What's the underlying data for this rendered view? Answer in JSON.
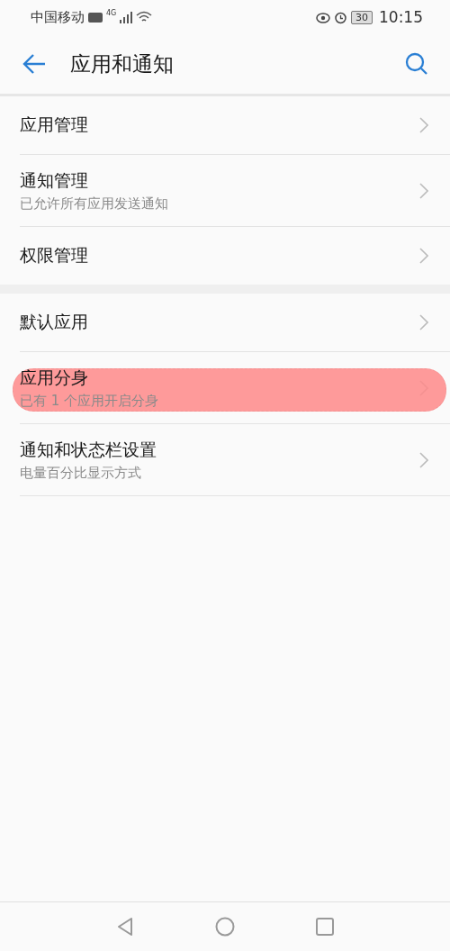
{
  "status_bar": {
    "carrier": "中国移动",
    "network": "4G",
    "battery": "30",
    "time": "10:15"
  },
  "header": {
    "title": "应用和通知"
  },
  "sections": [
    {
      "items": [
        {
          "title": "应用管理",
          "highlighted": false
        },
        {
          "title": "通知管理",
          "subtitle": "已允许所有应用发送通知",
          "highlighted": false
        },
        {
          "title": "权限管理",
          "highlighted": false
        }
      ]
    },
    {
      "items": [
        {
          "title": "默认应用",
          "highlighted": false
        },
        {
          "title": "应用分身",
          "subtitle": "已有 1 个应用开启分身",
          "highlighted": true
        },
        {
          "title": "通知和状态栏设置",
          "subtitle": "电量百分比显示方式",
          "highlighted": false
        }
      ]
    }
  ]
}
